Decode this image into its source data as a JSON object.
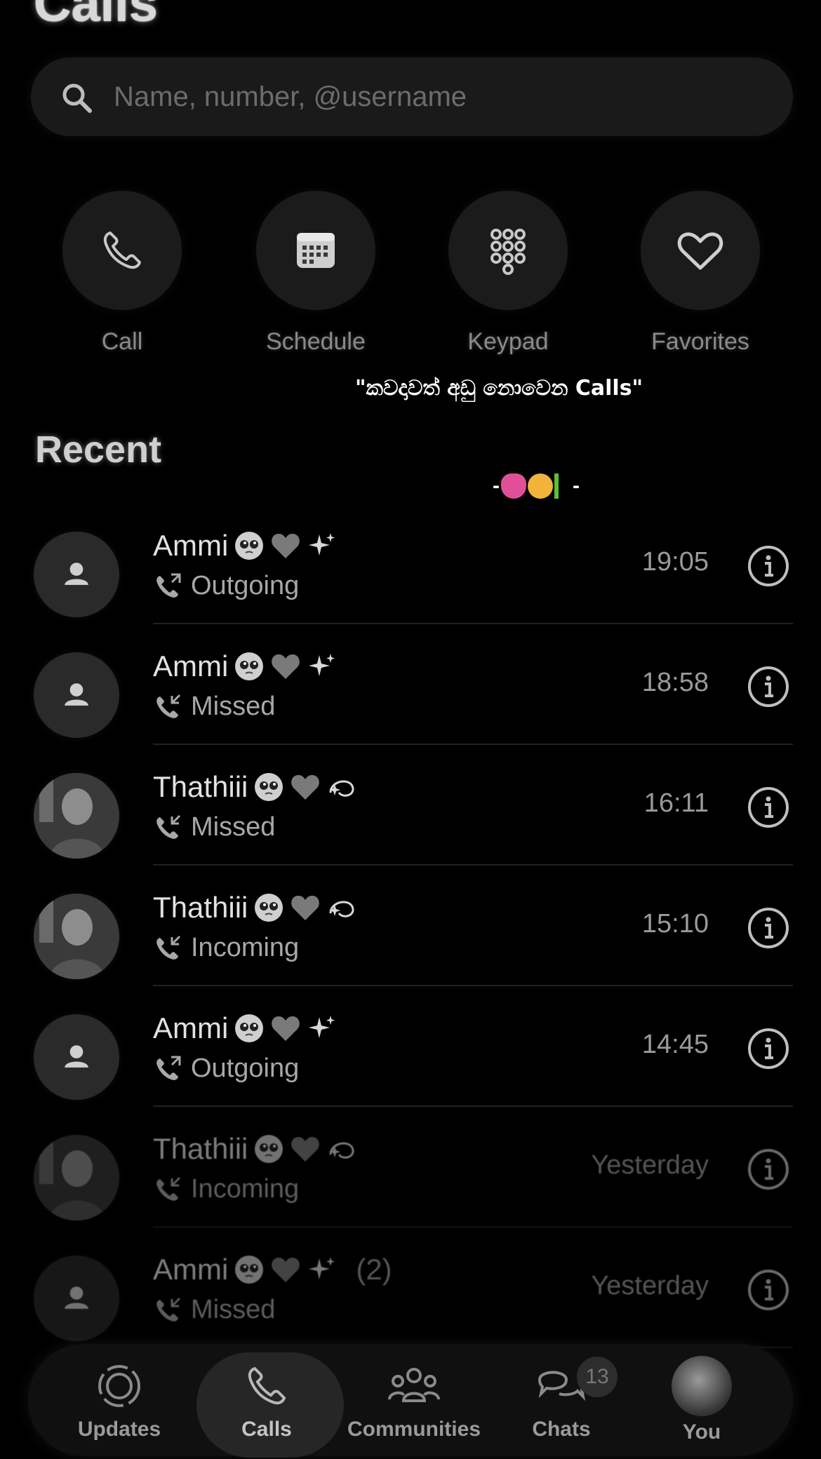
{
  "header": {
    "title": "Calls"
  },
  "search": {
    "placeholder": "Name, number, @username"
  },
  "quick_actions": [
    {
      "label": "Call",
      "icon": "phone-icon"
    },
    {
      "label": "Schedule",
      "icon": "calendar-icon"
    },
    {
      "label": "Keypad",
      "icon": "keypad-icon"
    },
    {
      "label": "Favorites",
      "icon": "heart-icon"
    }
  ],
  "caption": {
    "text": "\"කවදාවත් අඩු නොවෙන Calls\"",
    "emoji_line_dashes": [
      "-",
      "-"
    ]
  },
  "section": {
    "recent_title": "Recent"
  },
  "calls": [
    {
      "name": "Ammi",
      "status": "Outgoing",
      "time": "19:05",
      "direction": "outgoing",
      "avatar": "default-avatar",
      "count": ""
    },
    {
      "name": "Ammi",
      "status": "Missed",
      "time": "18:58",
      "direction": "missed",
      "avatar": "default-avatar",
      "count": ""
    },
    {
      "name": "Thathiii",
      "status": "Missed",
      "time": "16:11",
      "direction": "missed",
      "avatar": "photo-avatar",
      "count": ""
    },
    {
      "name": "Thathiii",
      "status": "Incoming",
      "time": "15:10",
      "direction": "incoming",
      "avatar": "photo-avatar",
      "count": ""
    },
    {
      "name": "Ammi",
      "status": "Outgoing",
      "time": "14:45",
      "direction": "outgoing",
      "avatar": "default-avatar",
      "count": ""
    },
    {
      "name": "Thathiii",
      "status": "Incoming",
      "time": "Yesterday",
      "direction": "incoming",
      "avatar": "photo-avatar",
      "count": ""
    },
    {
      "name": "Ammi",
      "status": "Missed",
      "time": "Yesterday",
      "direction": "missed",
      "avatar": "default-avatar",
      "count": "(2)"
    }
  ],
  "tabs": [
    {
      "label": "Updates",
      "icon": "updates-icon",
      "active": false,
      "badge": ""
    },
    {
      "label": "Calls",
      "icon": "phone-icon",
      "active": true,
      "badge": ""
    },
    {
      "label": "Communities",
      "icon": "communities-icon",
      "active": false,
      "badge": ""
    },
    {
      "label": "Chats",
      "icon": "chats-icon",
      "active": false,
      "badge": "13"
    },
    {
      "label": "You",
      "icon": "profile-avatar",
      "active": false,
      "badge": ""
    }
  ],
  "colors": {
    "background": "#000000",
    "surface": "#1b1b1b",
    "text_secondary": "#8a8a8a"
  }
}
